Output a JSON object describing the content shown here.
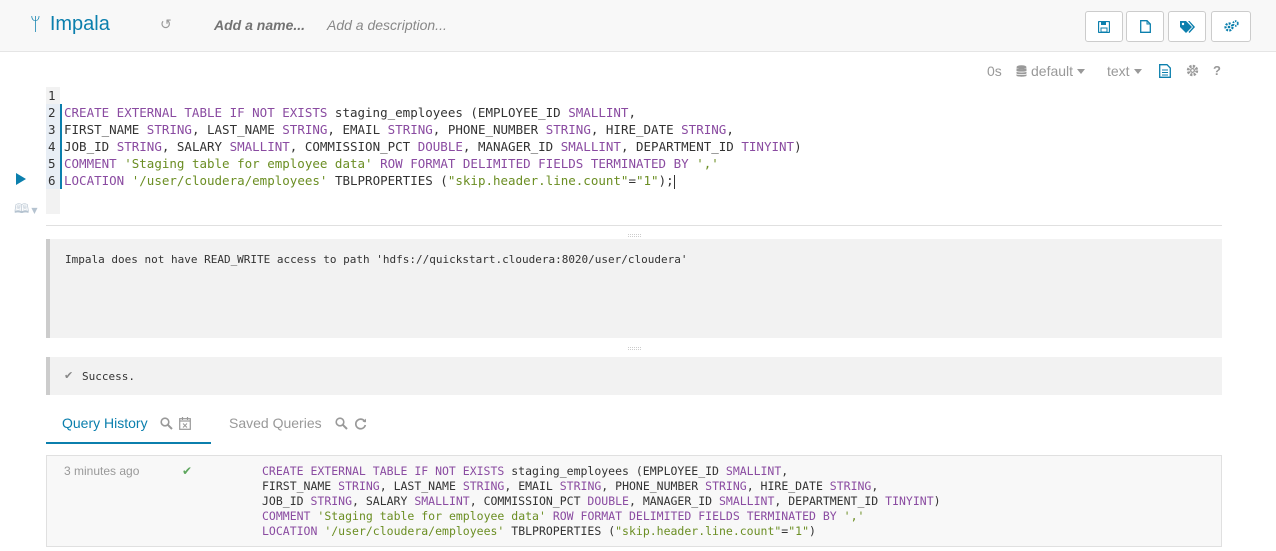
{
  "header": {
    "app_name": "Impala",
    "app_icon": "impala-icon",
    "name_placeholder": "Add a name...",
    "description_placeholder": "Add a description...",
    "buttons": [
      "save-icon",
      "new-document-icon",
      "tags-icon",
      "settings-cogs-icon"
    ]
  },
  "editor_toolbar": {
    "duration": "0s",
    "database": "default",
    "format": "text",
    "help": "?"
  },
  "editor": {
    "line_numbers": [
      "1",
      "2",
      "3",
      "4",
      "5",
      "6"
    ],
    "lines": [
      [],
      [
        {
          "t": "CREATE EXTERNAL TABLE IF NOT EXISTS",
          "c": "kw"
        },
        {
          "t": " staging_employees (EMPLOYEE_ID ",
          "c": ""
        },
        {
          "t": "SMALLINT",
          "c": "kw"
        },
        {
          "t": ",",
          "c": ""
        }
      ],
      [
        {
          "t": "FIRST_NAME ",
          "c": ""
        },
        {
          "t": "STRING",
          "c": "kw"
        },
        {
          "t": ", LAST_NAME ",
          "c": ""
        },
        {
          "t": "STRING",
          "c": "kw"
        },
        {
          "t": ", EMAIL ",
          "c": ""
        },
        {
          "t": "STRING",
          "c": "kw"
        },
        {
          "t": ", PHONE_NUMBER ",
          "c": ""
        },
        {
          "t": "STRING",
          "c": "kw"
        },
        {
          "t": ", HIRE_DATE ",
          "c": ""
        },
        {
          "t": "STRING",
          "c": "kw"
        },
        {
          "t": ",",
          "c": ""
        }
      ],
      [
        {
          "t": "JOB_ID ",
          "c": ""
        },
        {
          "t": "STRING",
          "c": "kw"
        },
        {
          "t": ", SALARY ",
          "c": ""
        },
        {
          "t": "SMALLINT",
          "c": "kw"
        },
        {
          "t": ", COMMISSION_PCT ",
          "c": ""
        },
        {
          "t": "DOUBLE",
          "c": "kw"
        },
        {
          "t": ", MANAGER_ID ",
          "c": ""
        },
        {
          "t": "SMALLINT",
          "c": "kw"
        },
        {
          "t": ", DEPARTMENT_ID ",
          "c": ""
        },
        {
          "t": "TINYINT",
          "c": "kw"
        },
        {
          "t": ")",
          "c": ""
        }
      ],
      [
        {
          "t": "COMMENT",
          "c": "kw"
        },
        {
          "t": " ",
          "c": ""
        },
        {
          "t": "'Staging table for employee data'",
          "c": "str"
        },
        {
          "t": " ",
          "c": ""
        },
        {
          "t": "ROW FORMAT DELIMITED FIELDS TERMINATED BY",
          "c": "kw"
        },
        {
          "t": " ",
          "c": ""
        },
        {
          "t": "','",
          "c": "str"
        }
      ],
      [
        {
          "t": "LOCATION",
          "c": "kw"
        },
        {
          "t": " ",
          "c": ""
        },
        {
          "t": "'/user/cloudera/employees'",
          "c": "str"
        },
        {
          "t": " TBLPROPERTIES (",
          "c": ""
        },
        {
          "t": "\"skip.header.line.count\"",
          "c": "str"
        },
        {
          "t": "=",
          "c": ""
        },
        {
          "t": "\"1\"",
          "c": "str"
        },
        {
          "t": ");",
          "c": ""
        }
      ]
    ]
  },
  "results": {
    "error_message": "Impala does not have READ_WRITE access to path 'hdfs://quickstart.cloudera:8020/user/cloudera'",
    "success_message": "Success."
  },
  "tabs": {
    "query_history": "Query History",
    "saved_queries": "Saved Queries"
  },
  "history": {
    "time": "3 minutes ago",
    "status": "success",
    "lines": [
      [
        {
          "t": "CREATE EXTERNAL TABLE IF NOT EXISTS",
          "c": "kw"
        },
        {
          "t": " staging_employees (EMPLOYEE_ID ",
          "c": ""
        },
        {
          "t": "SMALLINT",
          "c": "kw"
        },
        {
          "t": ",",
          "c": ""
        }
      ],
      [
        {
          "t": "FIRST_NAME ",
          "c": ""
        },
        {
          "t": "STRING",
          "c": "kw"
        },
        {
          "t": ", LAST_NAME ",
          "c": ""
        },
        {
          "t": "STRING",
          "c": "kw"
        },
        {
          "t": ", EMAIL ",
          "c": ""
        },
        {
          "t": "STRING",
          "c": "kw"
        },
        {
          "t": ", PHONE_NUMBER ",
          "c": ""
        },
        {
          "t": "STRING",
          "c": "kw"
        },
        {
          "t": ", HIRE_DATE ",
          "c": ""
        },
        {
          "t": "STRING",
          "c": "kw"
        },
        {
          "t": ",",
          "c": ""
        }
      ],
      [
        {
          "t": "JOB_ID ",
          "c": ""
        },
        {
          "t": "STRING",
          "c": "kw"
        },
        {
          "t": ", SALARY ",
          "c": ""
        },
        {
          "t": "SMALLINT",
          "c": "kw"
        },
        {
          "t": ", COMMISSION_PCT ",
          "c": ""
        },
        {
          "t": "DOUBLE",
          "c": "kw"
        },
        {
          "t": ", MANAGER_ID ",
          "c": ""
        },
        {
          "t": "SMALLINT",
          "c": "kw"
        },
        {
          "t": ", DEPARTMENT_ID ",
          "c": ""
        },
        {
          "t": "TINYINT",
          "c": "kw"
        },
        {
          "t": ")",
          "c": ""
        }
      ],
      [
        {
          "t": "COMMENT",
          "c": "kw"
        },
        {
          "t": " ",
          "c": ""
        },
        {
          "t": "'Staging table for employee data'",
          "c": "str"
        },
        {
          "t": " ",
          "c": ""
        },
        {
          "t": "ROW FORMAT DELIMITED FIELDS TERMINATED BY",
          "c": "kw"
        },
        {
          "t": " ",
          "c": ""
        },
        {
          "t": "','",
          "c": "str"
        }
      ],
      [
        {
          "t": "LOCATION",
          "c": "kw"
        },
        {
          "t": " ",
          "c": ""
        },
        {
          "t": "'/user/cloudera/employees'",
          "c": "str"
        },
        {
          "t": " TBLPROPERTIES (",
          "c": ""
        },
        {
          "t": "\"skip.header.line.count\"",
          "c": "str"
        },
        {
          "t": "=",
          "c": ""
        },
        {
          "t": "\"1\"",
          "c": "str"
        },
        {
          "t": ")",
          "c": ""
        }
      ]
    ]
  },
  "colors": {
    "accent": "#0b7fad",
    "keyword": "#8a4ba1",
    "string": "#6b8e23",
    "success_check": "#5ea65e"
  }
}
